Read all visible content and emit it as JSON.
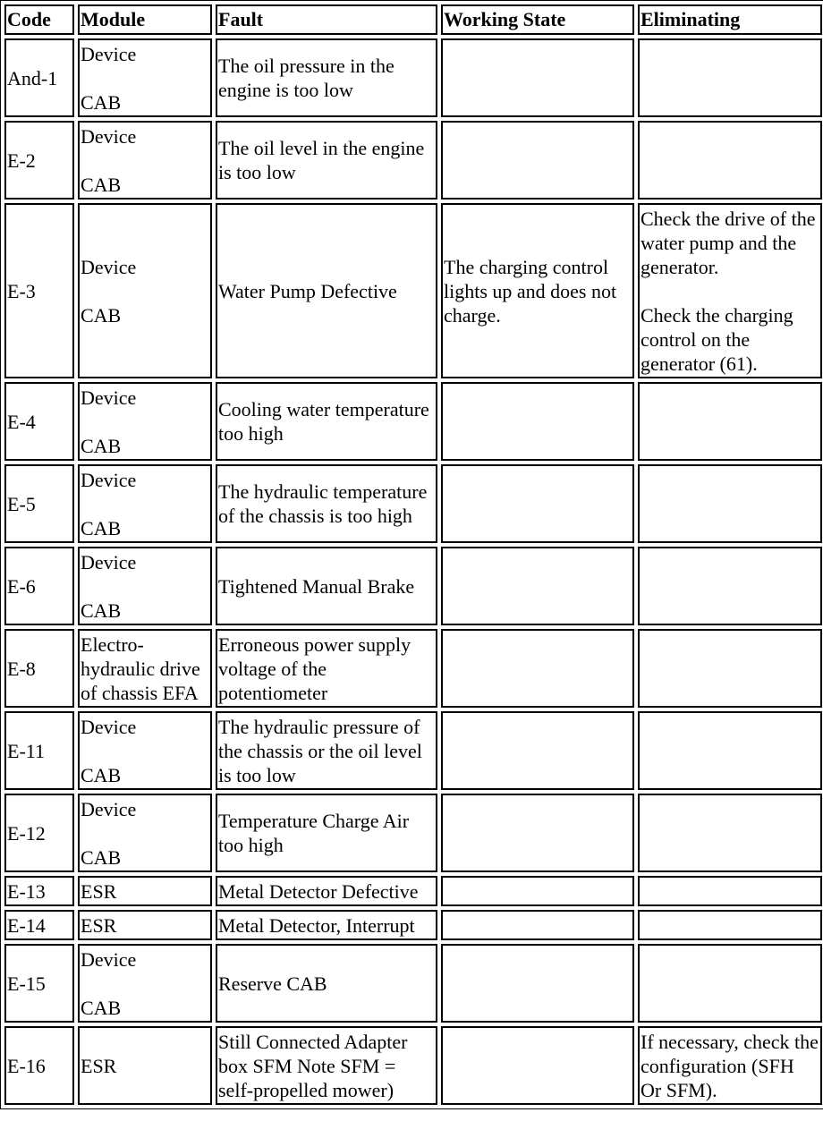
{
  "table": {
    "headers": {
      "code": "Code",
      "module": "Module",
      "fault": "Fault",
      "working_state": "Working State",
      "eliminating": "Eliminating"
    },
    "rows": [
      {
        "code": "And-1",
        "module": [
          "Device",
          "CAB"
        ],
        "fault": "The oil pressure in the engine is too low",
        "working_state": "",
        "eliminating": []
      },
      {
        "code": "E-2",
        "module": [
          "Device",
          "CAB"
        ],
        "fault": "The oil level in the engine is too low",
        "working_state": "",
        "eliminating": []
      },
      {
        "code": "E-3",
        "module": [
          "Device",
          "CAB"
        ],
        "fault": "Water Pump Defective",
        "working_state": "The charging control lights up and does not charge.",
        "eliminating": [
          "Check the drive of the water pump and the generator.",
          "Check the charging control on the generator (61)."
        ]
      },
      {
        "code": "E-4",
        "module": [
          "Device",
          "CAB"
        ],
        "fault": "Cooling water temperature too high",
        "working_state": "",
        "eliminating": []
      },
      {
        "code": "E-5",
        "module": [
          "Device",
          "CAB"
        ],
        "fault": "The hydraulic temperature of the chassis is too high",
        "working_state": "",
        "eliminating": []
      },
      {
        "code": "E-6",
        "module": [
          "Device",
          "CAB"
        ],
        "fault": "Tightened Manual Brake",
        "working_state": "",
        "eliminating": []
      },
      {
        "code": "E-8",
        "module": [
          "Electro-hydraulic drive of chassis EFA"
        ],
        "fault": "Erroneous power supply voltage of the potentiometer",
        "working_state": "",
        "eliminating": []
      },
      {
        "code": "E-11",
        "module": [
          "Device",
          "CAB"
        ],
        "fault": "The hydraulic pressure of the chassis or the oil level is too low",
        "working_state": "",
        "eliminating": []
      },
      {
        "code": "E-12",
        "module": [
          "Device",
          "CAB"
        ],
        "fault": "Temperature Charge Air too high",
        "working_state": "",
        "eliminating": []
      },
      {
        "code": "E-13",
        "module": [
          "ESR"
        ],
        "fault": "Metal Detector Defective",
        "working_state": "",
        "eliminating": []
      },
      {
        "code": "E-14",
        "module": [
          "ESR"
        ],
        "fault": "Metal Detector, Interrupt",
        "working_state": "",
        "eliminating": []
      },
      {
        "code": "E-15",
        "module": [
          "Device",
          "CAB"
        ],
        "fault": "Reserve CAB",
        "working_state": "",
        "eliminating": []
      },
      {
        "code": "E-16",
        "module": [
          "ESR"
        ],
        "fault": "Still Connected Adapter box SFM Note SFM = self-propelled mower)",
        "working_state": "",
        "eliminating": [
          "If necessary, check the configuration (SFH Or SFM)."
        ]
      }
    ]
  }
}
